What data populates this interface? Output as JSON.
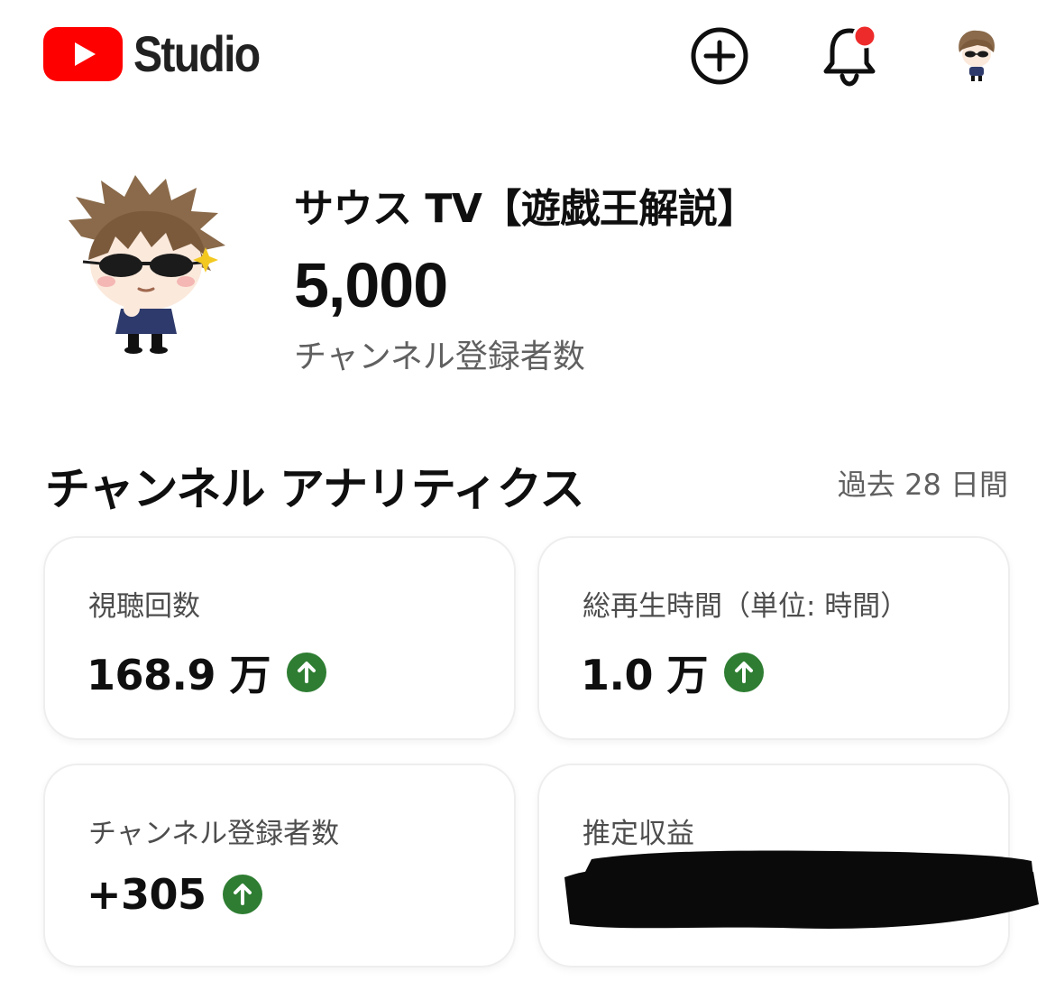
{
  "header": {
    "logo_text": "Studio",
    "icons": [
      "youtube-logo-icon",
      "create-icon",
      "bell-icon",
      "avatar"
    ],
    "accent": "#ff0000",
    "notification_dot_color": "#ee2b2b"
  },
  "channel": {
    "name": "サウス TV【遊戯王解説】",
    "subscriber_count": "5,000",
    "subscriber_label": "チャンネル登録者数"
  },
  "analytics": {
    "title": "チャンネル アナリティクス",
    "period": "過去 28 日間",
    "cards": [
      {
        "label": "視聴回数",
        "value": "168.9 万",
        "trend": "up"
      },
      {
        "label": "総再生時間（単位: 時間）",
        "value": "1.0 万",
        "trend": "up"
      },
      {
        "label": "チャンネル登録者数",
        "value": "+305",
        "trend": "up"
      },
      {
        "label": "推定収益",
        "value": "",
        "redacted": true
      }
    ],
    "trend_color": "#2e7d32"
  }
}
